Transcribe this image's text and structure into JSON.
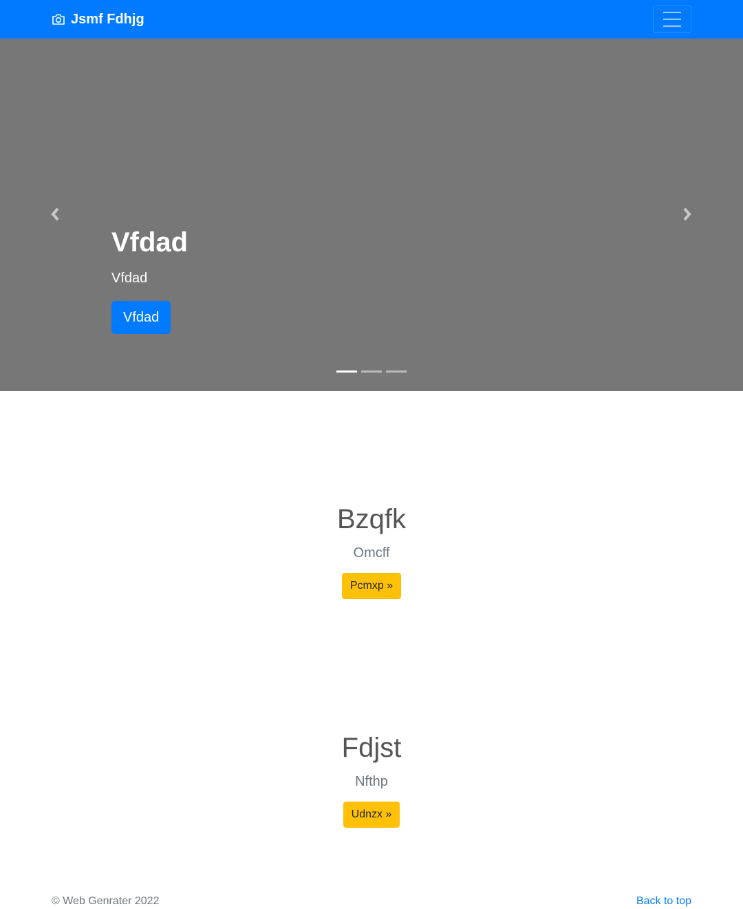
{
  "navbar": {
    "brand_icon": "camera-icon",
    "brand": "Jsmf Fdhjg",
    "toggler_icon": "hamburger-menu-icon",
    "color": "#007bff"
  },
  "carousel": {
    "background": "#777777",
    "heading": "Vfdad",
    "text": "Vfdad",
    "button": "Vfdad",
    "prev_icon": "chevron-left-icon",
    "next_icon": "chevron-right-icon",
    "slide_count": 3,
    "active_slide": 1
  },
  "sections": [
    {
      "heading": "Bzqfk",
      "lead": "Omcff",
      "button": "Pcmxp »"
    },
    {
      "heading": "Fdjst",
      "lead": "Nfthp",
      "button": "Udnzx »"
    }
  ],
  "footer": {
    "copyright": "© Web Genrater 2022",
    "back_to_top": "Back to top"
  }
}
